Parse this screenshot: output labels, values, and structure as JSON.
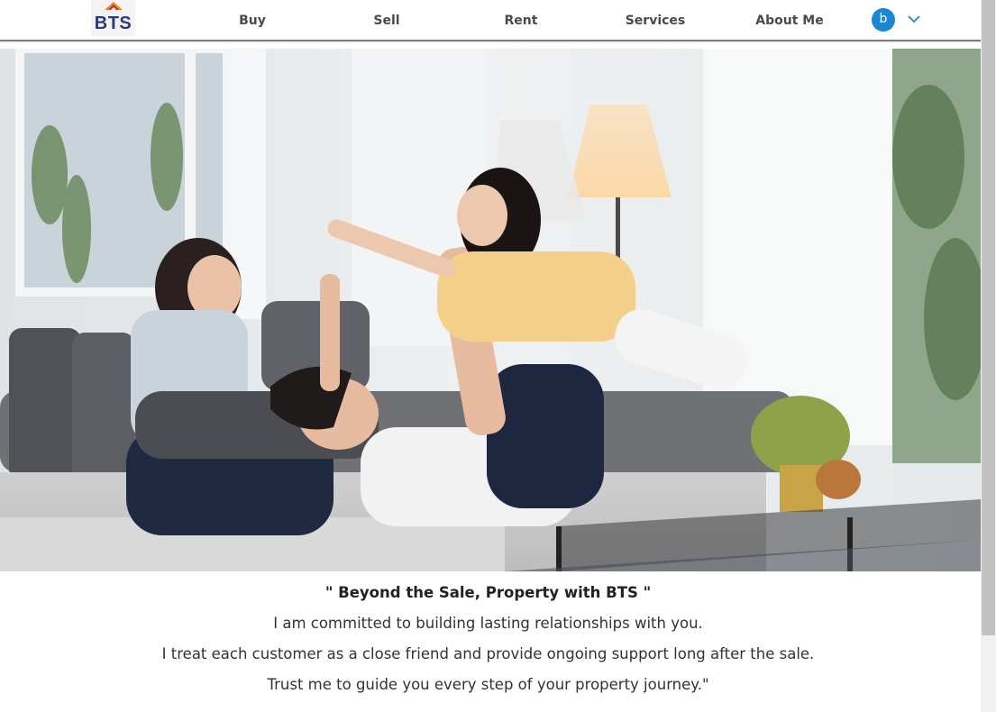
{
  "header": {
    "logo_text": "BTS",
    "nav": [
      "Buy",
      "Sell",
      "Rent",
      "Services",
      "About Me"
    ],
    "avatar_letter": "b"
  },
  "hero": {
    "image_description_icon": "family-playing-on-sofa-photo"
  },
  "content": {
    "slogan": "\" Beyond the Sale, Property with BTS \"",
    "lines": [
      "I am committed to building lasting relationships with you.",
      "I treat each customer as a close friend and provide ongoing support long after the sale.",
      "Trust me to guide you every step of your property journey.\""
    ]
  },
  "colors": {
    "brand_navy": "#2d3a78",
    "avatar_blue": "#1a86d6",
    "header_border": "#7d7d7d"
  }
}
